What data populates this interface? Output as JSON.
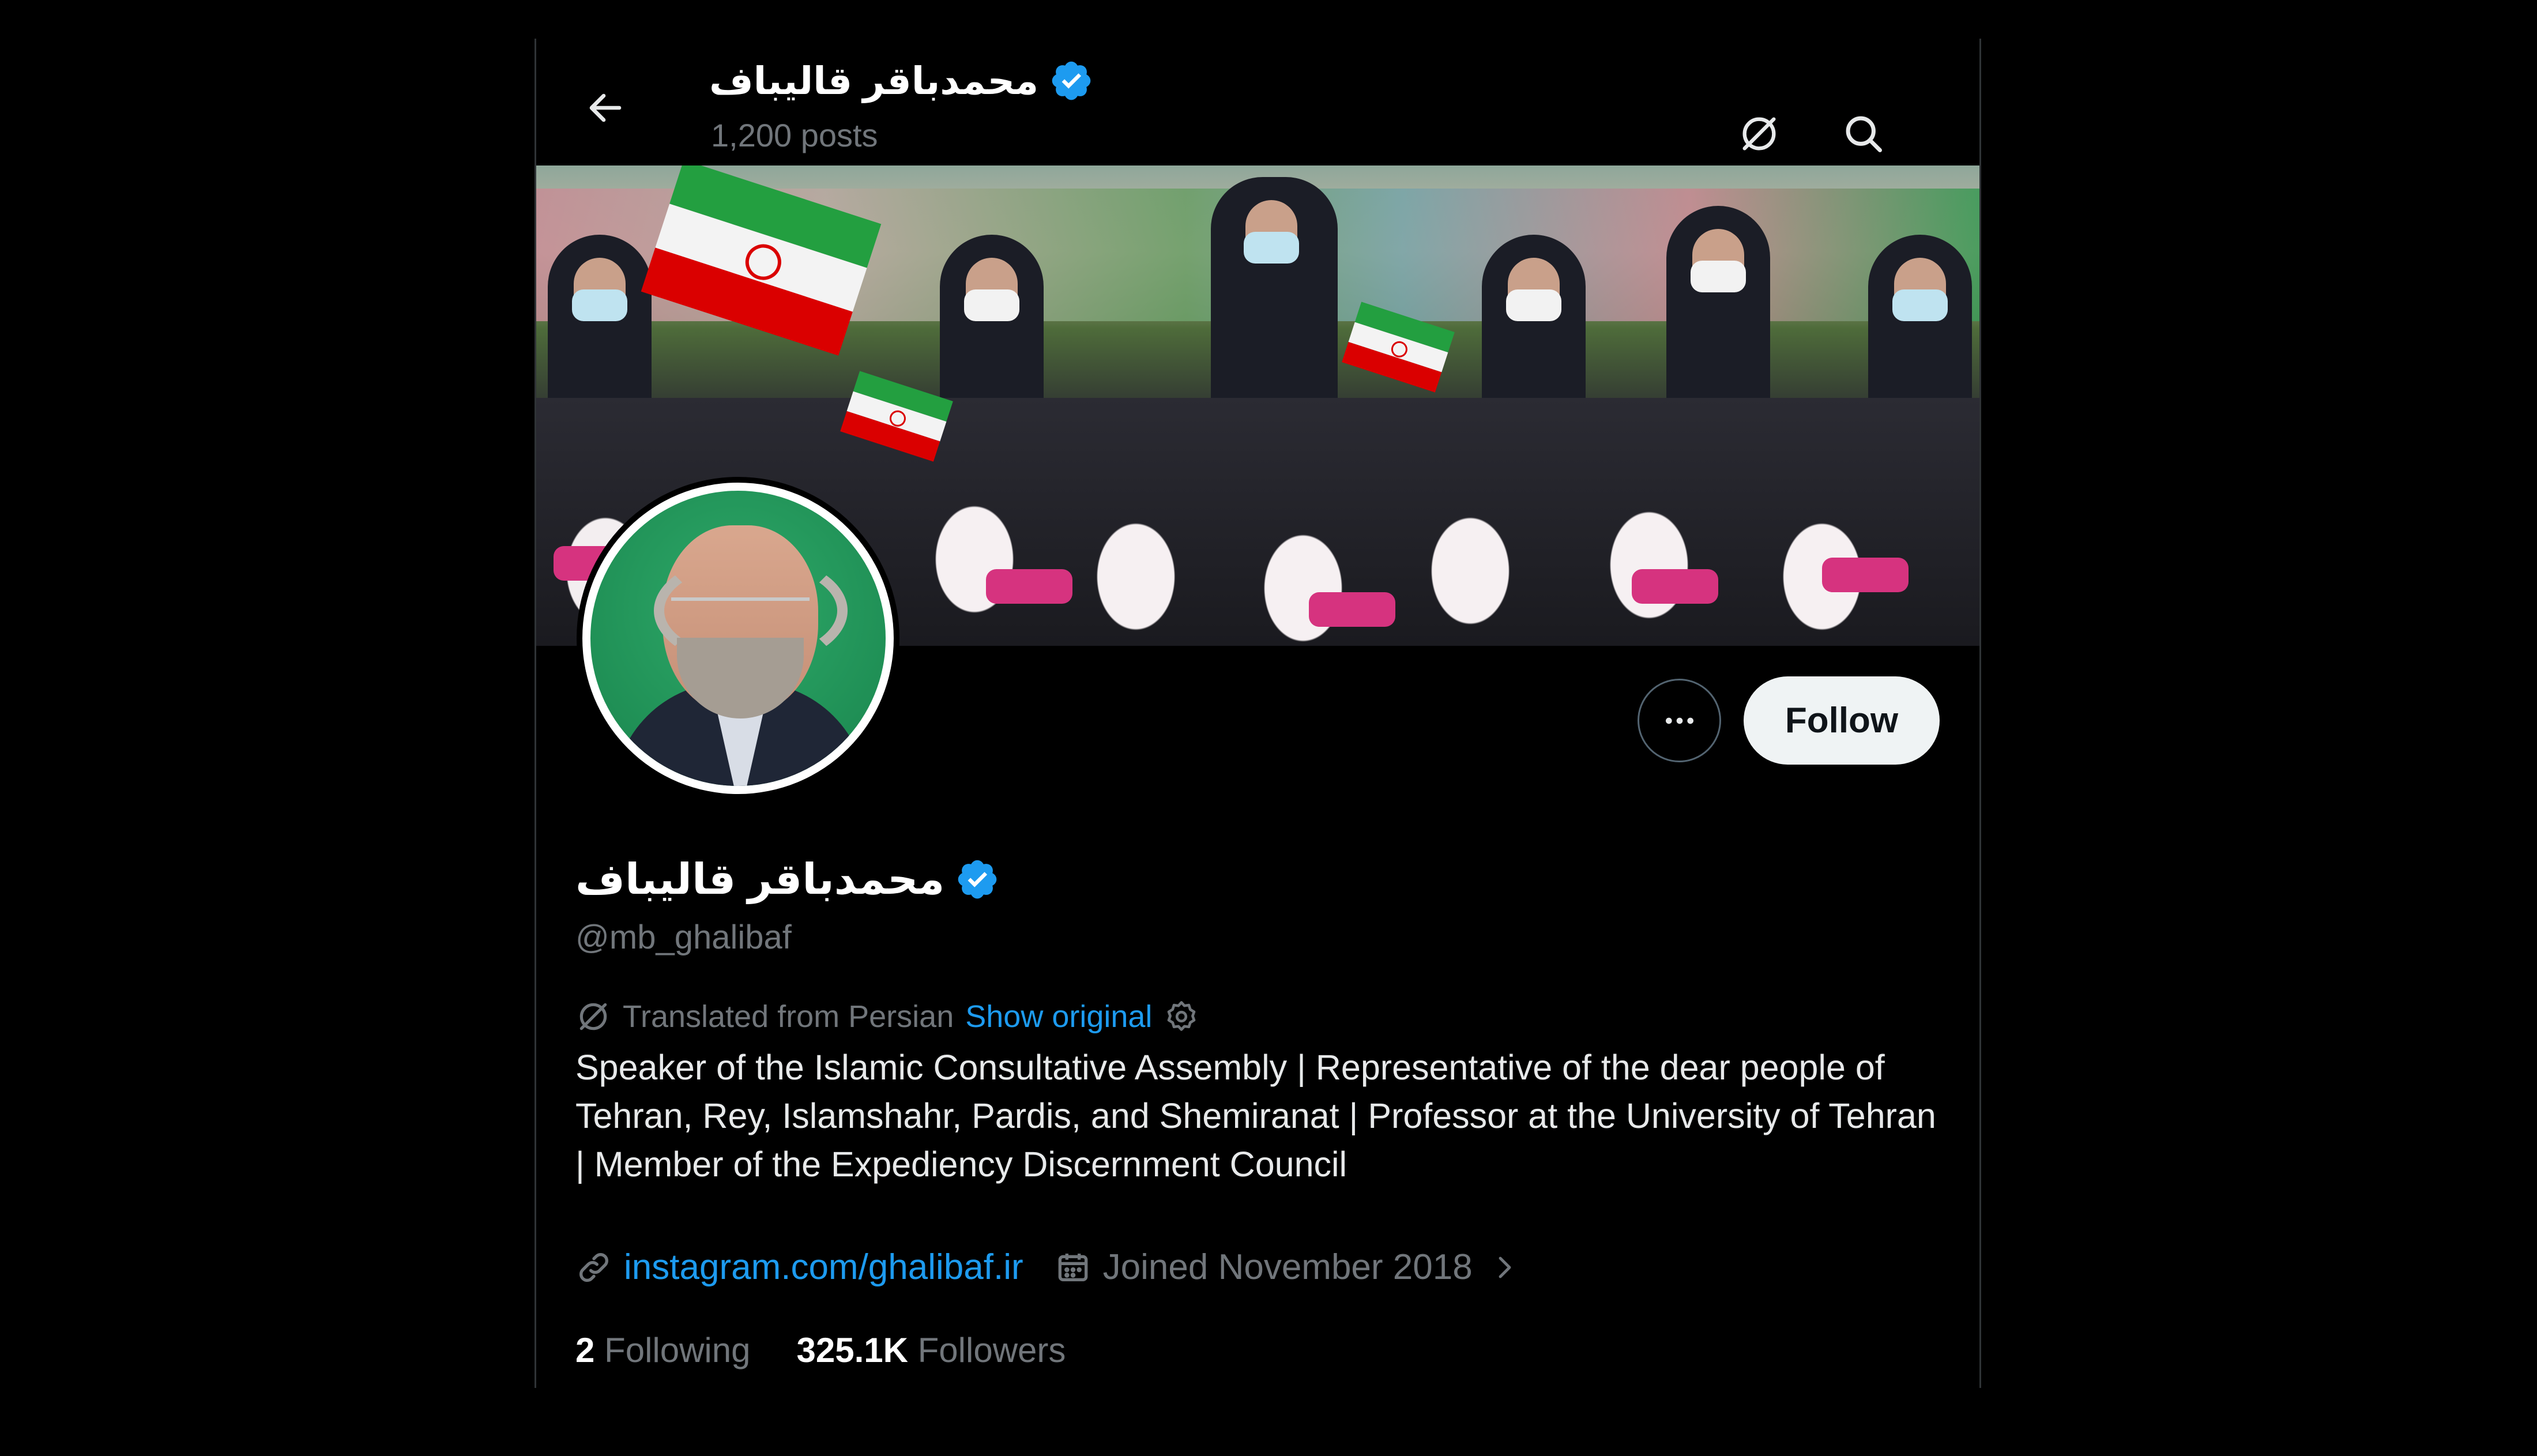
{
  "header": {
    "display_name": "محمدباقر قالیباف",
    "posts_count": "1,200 posts"
  },
  "profile": {
    "display_name": "محمدباقر قالیباف",
    "handle": "@mb_ghalibaf",
    "translation_note": "Translated from Persian",
    "show_original_label": "Show original",
    "bio": "Speaker of the Islamic Consultative Assembly | Representative of the dear people of Tehran, Rey, Islamshahr, Pardis, and Shemiranat | Professor at the University of Tehran | Member of the Expediency Discernment Council",
    "website": "instagram.com/ghalibaf.ir",
    "joined": "Joined November 2018",
    "following_count": "2",
    "following_label": "Following",
    "followers_count": "325.1K",
    "followers_label": "Followers"
  },
  "actions": {
    "follow_label": "Follow"
  },
  "icons": {
    "back": "arrow-left-icon",
    "translate": "translate-icon",
    "search": "search-icon",
    "verified": "verified-badge-icon",
    "more": "more-dots-icon",
    "settings": "gear-icon",
    "link": "link-icon",
    "calendar": "calendar-icon",
    "chevron": "chevron-right-icon"
  },
  "colors": {
    "accent": "#1d9bf0",
    "background": "#000000",
    "secondary_text": "#71767b",
    "follow_button_bg": "#eff3f4"
  }
}
